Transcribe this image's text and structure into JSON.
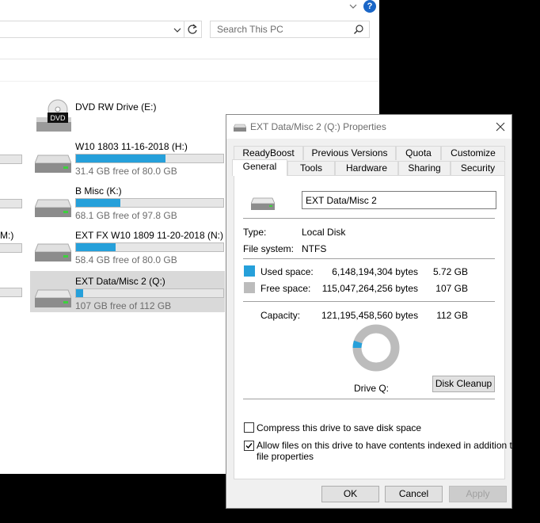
{
  "explorer": {
    "search_placeholder": "Search This PC",
    "left_partial_label": "M:)",
    "drives": [
      {
        "name": "DVD RW Drive (E:)",
        "free_text": "",
        "used_fraction": null,
        "icon": "dvd-drive-icon"
      },
      {
        "name": "W10 1803 11-16-2018 (H:)",
        "free_text": "31.4 GB free of 80.0 GB",
        "used_fraction": 0.61,
        "icon": "hard-drive-icon"
      },
      {
        "name": "B Misc (K:)",
        "free_text": "68.1 GB free of 97.8 GB",
        "used_fraction": 0.3,
        "icon": "hard-drive-icon"
      },
      {
        "name": "EXT FX W10 1809 11-20-2018 (N:)",
        "free_text": "58.4 GB free of 80.0 GB",
        "used_fraction": 0.27,
        "icon": "hard-drive-icon"
      },
      {
        "name": "EXT Data/Misc 2 (Q:)",
        "free_text": "107 GB free of 112 GB",
        "used_fraction": 0.05,
        "icon": "hard-drive-icon"
      }
    ],
    "dvd_badge": "DVD"
  },
  "dialog": {
    "title": "EXT Data/Misc 2 (Q:) Properties",
    "tabs_row1": [
      "ReadyBoost",
      "Previous Versions",
      "Quota",
      "Customize"
    ],
    "tabs_row2": [
      "General",
      "Tools",
      "Hardware",
      "Sharing",
      "Security"
    ],
    "active_tab": "General",
    "drive_label": "EXT Data/Misc 2",
    "type_label": "Type:",
    "type_value": "Local Disk",
    "fs_label": "File system:",
    "fs_value": "NTFS",
    "used_label": "Used space:",
    "used_bytes": "6,148,194,304 bytes",
    "used_gb": "5.72 GB",
    "free_label": "Free space:",
    "free_bytes": "115,047,264,256 bytes",
    "free_gb": "107 GB",
    "capacity_label": "Capacity:",
    "capacity_bytes": "121,195,458,560 bytes",
    "capacity_gb": "112 GB",
    "used_fraction": 0.0507,
    "drive_caption": "Drive Q:",
    "cleanup_button": "Disk Cleanup",
    "compress_label": "Compress this drive to save disk space",
    "compress_checked": false,
    "index_label_line1": "Allow files on this drive to have contents indexed in addition to",
    "index_label_line2": "file properties",
    "index_checked": true,
    "ok_button": "OK",
    "cancel_button": "Cancel",
    "apply_button": "Apply",
    "colors": {
      "used": "#26a0da",
      "free": "#bcbcbc",
      "bar_fill": "#26a0da"
    }
  }
}
